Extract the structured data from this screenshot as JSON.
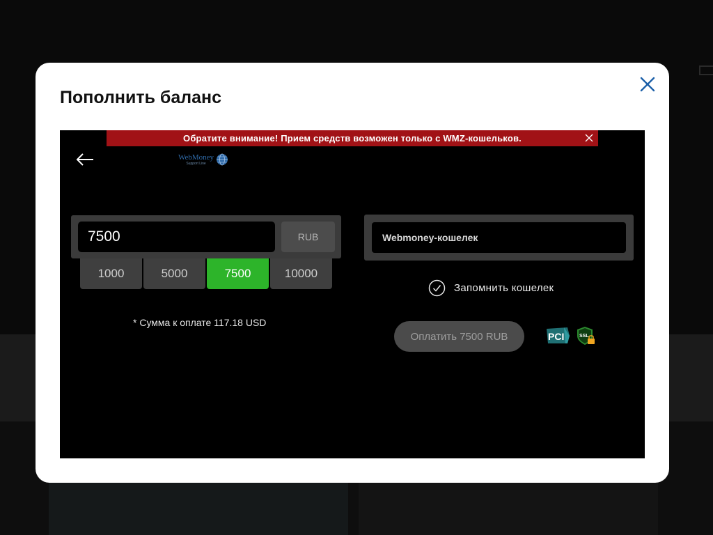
{
  "modal": {
    "title": "Пополнить баланс"
  },
  "notice": {
    "text": "Обратите внимание! Прием средств возможен только с WMZ-кошельков."
  },
  "logo": {
    "name": "WebMoney",
    "subtitle": "Support Line"
  },
  "amount": {
    "value": "7500",
    "currency": "RUB",
    "presets": [
      "1000",
      "5000",
      "7500",
      "10000"
    ],
    "selected_preset": "7500",
    "note": "* Сумма к оплате 117.18 USD"
  },
  "wallet": {
    "placeholder": "Webmoney-кошелек",
    "remember_label": "Запомнить кошелек",
    "remember_checked": true
  },
  "pay_button": {
    "label": "Оплатить 7500 RUB"
  },
  "badges": {
    "pci": "PCI",
    "ssl": "SSL"
  },
  "colors": {
    "accent_green": "#2db42a",
    "notice_red": "#a11216",
    "close_blue": "#1b5fa8"
  }
}
